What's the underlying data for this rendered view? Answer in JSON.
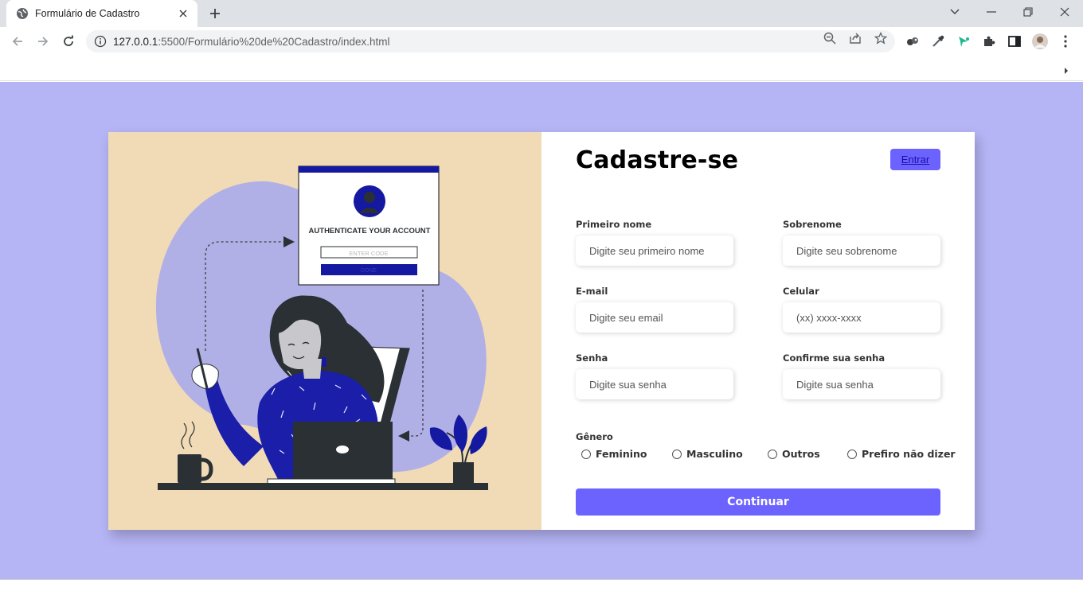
{
  "browser": {
    "tab_title": "Formulário de Cadastro",
    "url_host": "127.0.0.1",
    "url_rest": ":5500/Formulário%20de%20Cadastro/index.html"
  },
  "illustration": {
    "heading": "AUTHENTICATE YOUR ACCOUNT",
    "code_placeholder": "ENTER CODE",
    "button_text": "DONE"
  },
  "form": {
    "title": "Cadastre-se",
    "login_button": "Entrar",
    "fields": [
      {
        "label": "Primeiro nome",
        "placeholder": "Digite seu primeiro nome"
      },
      {
        "label": "Sobrenome",
        "placeholder": "Digite seu sobrenome"
      },
      {
        "label": "E-mail",
        "placeholder": "Digite seu email"
      },
      {
        "label": "Celular",
        "placeholder": "(xx) xxxx-xxxx"
      },
      {
        "label": "Senha",
        "placeholder": "Digite sua senha"
      },
      {
        "label": "Confirme sua senha",
        "placeholder": "Digite sua senha"
      }
    ],
    "gender": {
      "title": "Gênero",
      "options": [
        "Feminino",
        "Masculino",
        "Outros",
        "Prefiro não dizer"
      ]
    },
    "continue_button": "Continuar"
  },
  "colors": {
    "page_background": "#b5b4f5",
    "accent": "#6c63ff",
    "illustration_background": "#f1dbb6"
  }
}
